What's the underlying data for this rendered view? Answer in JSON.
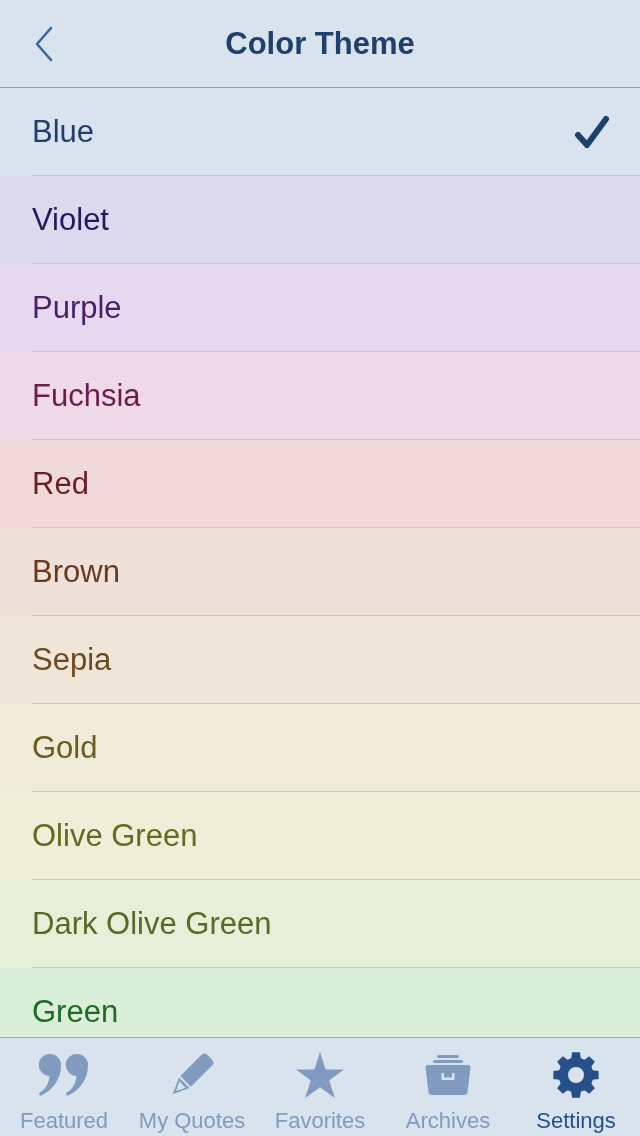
{
  "header": {
    "title": "Color Theme"
  },
  "themes": [
    {
      "label": "Blue",
      "color": "#1f3f6e",
      "selected": true
    },
    {
      "label": "Violet",
      "color": "#231a5e",
      "selected": false
    },
    {
      "label": "Purple",
      "color": "#4a1e69",
      "selected": false
    },
    {
      "label": "Fuchsia",
      "color": "#6a1d4c",
      "selected": false
    },
    {
      "label": "Red",
      "color": "#6b1f22",
      "selected": false
    },
    {
      "label": "Brown",
      "color": "#6b3a1e",
      "selected": false
    },
    {
      "label": "Sepia",
      "color": "#6b4a1f",
      "selected": false
    },
    {
      "label": "Gold",
      "color": "#6b5b1f",
      "selected": false
    },
    {
      "label": "Olive Green",
      "color": "#656b1f",
      "selected": false
    },
    {
      "label": "Dark Olive Green",
      "color": "#556b28",
      "selected": false
    },
    {
      "label": "Green",
      "color": "#1e6b22",
      "selected": false
    }
  ],
  "tab_bar": {
    "tabs": [
      {
        "label": "Featured",
        "selected": false
      },
      {
        "label": "My Quotes",
        "selected": false
      },
      {
        "label": "Favorites",
        "selected": false
      },
      {
        "label": "Archives",
        "selected": false
      },
      {
        "label": "Settings",
        "selected": true
      }
    ]
  }
}
